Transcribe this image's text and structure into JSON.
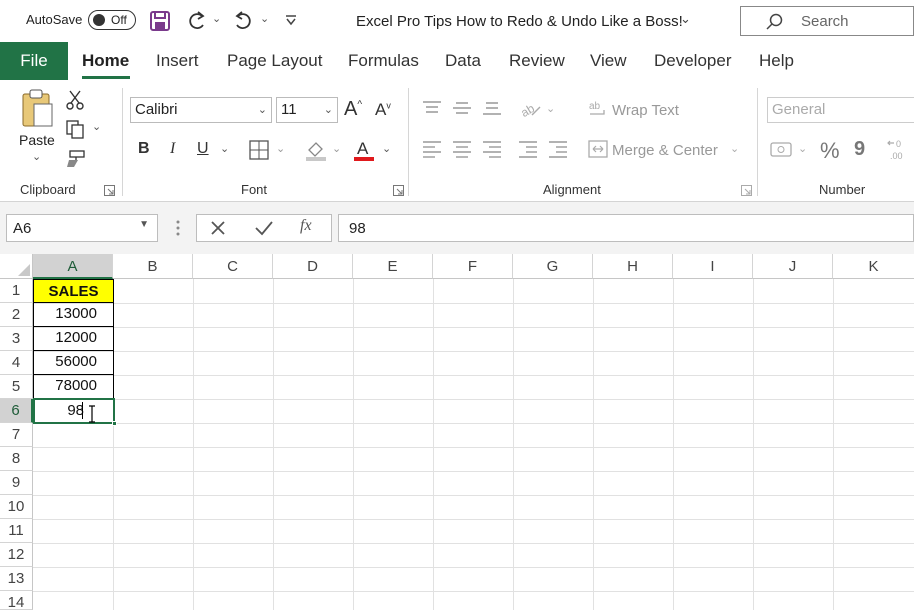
{
  "titlebar": {
    "autosave_label": "AutoSave",
    "autosave_state": "Off",
    "doc_title": "Excel Pro Tips How to Redo & Undo Like a Boss!",
    "search_placeholder": "Search"
  },
  "tabs": [
    "File",
    "Home",
    "Insert",
    "Page Layout",
    "Formulas",
    "Data",
    "Review",
    "View",
    "Developer",
    "Help"
  ],
  "active_tab": "Home",
  "ribbon": {
    "clipboard": {
      "paste_label": "Paste",
      "group_label": "Clipboard"
    },
    "font": {
      "font_name": "Calibri",
      "font_size": "11",
      "bold": "B",
      "italic": "I",
      "underline": "U",
      "group_label": "Font"
    },
    "alignment": {
      "wrap_text": "Wrap Text",
      "merge_center": "Merge & Center",
      "group_label": "Alignment"
    },
    "number": {
      "format": "General",
      "percent": "%",
      "comma": "9",
      "group_label": "Number"
    }
  },
  "formula_bar": {
    "name_box": "A6",
    "fx": "fx",
    "value": "98"
  },
  "columns": [
    "A",
    "B",
    "C",
    "D",
    "E",
    "F",
    "G",
    "H",
    "I",
    "J",
    "K"
  ],
  "rows": [
    "1",
    "2",
    "3",
    "4",
    "5",
    "6",
    "7",
    "8",
    "9",
    "10",
    "11",
    "12",
    "13",
    "14"
  ],
  "cells": {
    "A1": "SALES",
    "A2": "13000",
    "A3": "12000",
    "A4": "56000",
    "A5": "78000",
    "A6": "98"
  },
  "colors": {
    "excel_green": "#217346",
    "header_fill": "#ffff00",
    "selected": "#1e7145"
  }
}
